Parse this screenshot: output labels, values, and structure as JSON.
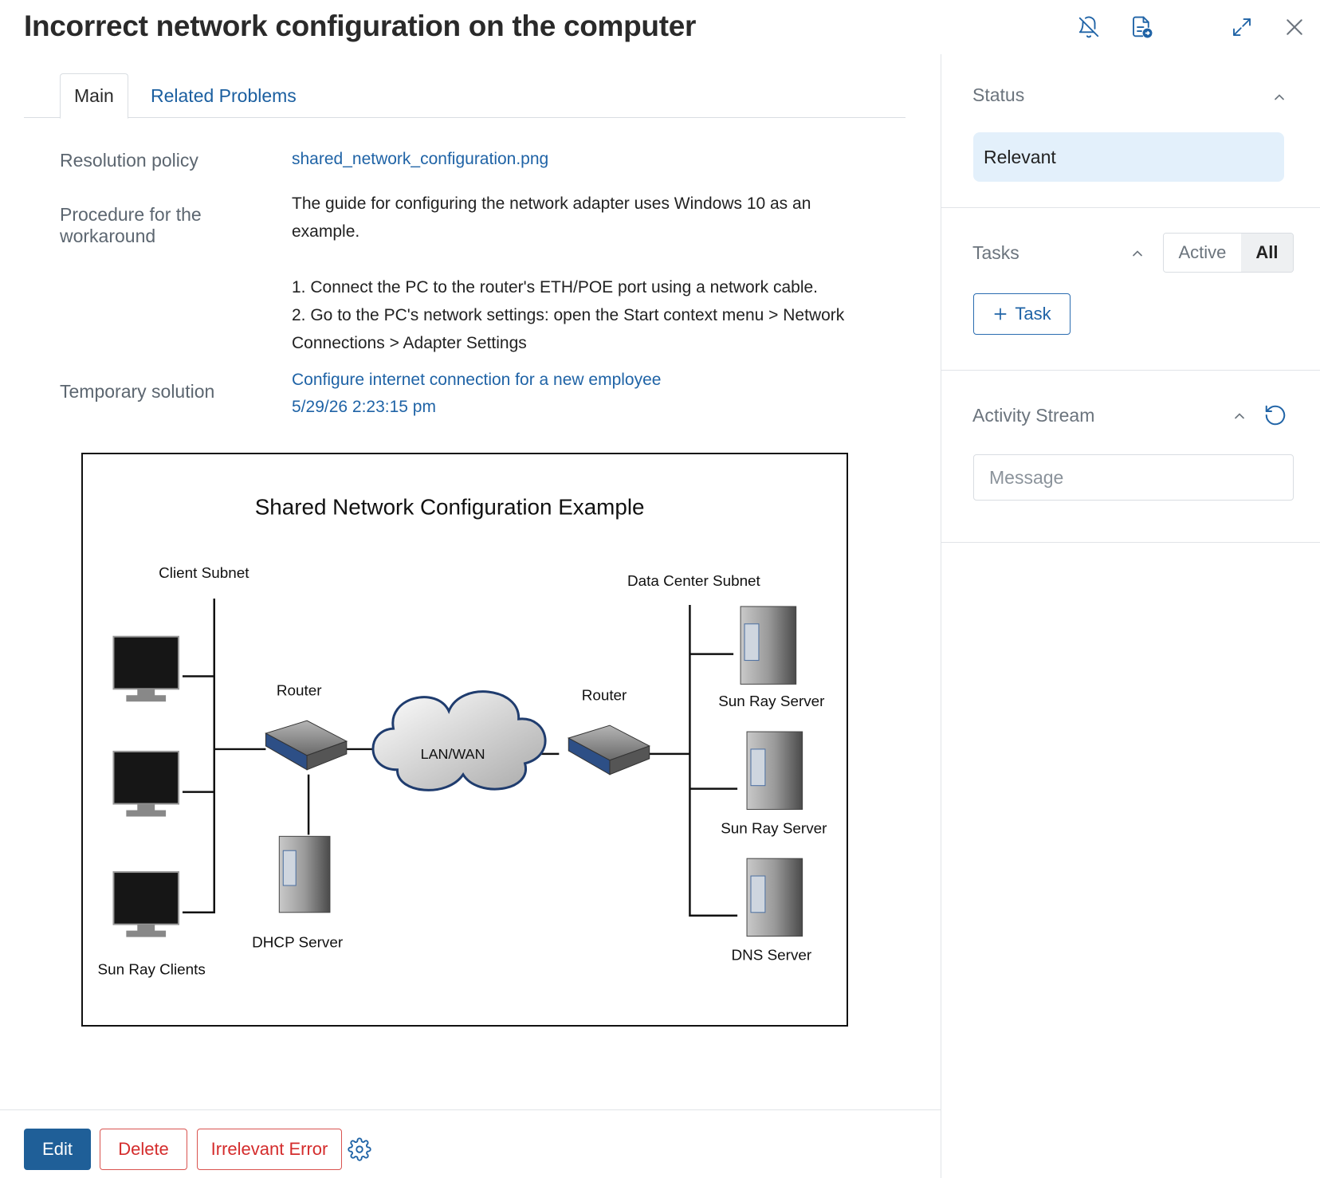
{
  "header": {
    "title": "Incorrect network configuration on the computer",
    "icons": [
      "bell-off-icon",
      "document-export-icon",
      "expand-icon",
      "close-icon"
    ]
  },
  "tabs": [
    {
      "label": "Main",
      "selected": true
    },
    {
      "label": "Related Problems",
      "selected": false
    }
  ],
  "fields": {
    "resolution_policy": {
      "label": "Resolution policy",
      "value": "shared_network_configuration.png"
    },
    "procedure": {
      "label_line1": "Procedure for the",
      "label_line2": "workaround",
      "intro_line1": "The guide for configuring the network adapter uses Windows 10 as an",
      "intro_line2": "example.",
      "step1": "1. Connect the PC to the router's ETH/POE port using a network cable.",
      "step2_line1": "2. Go to the PC's network settings: open the Start context menu > Network",
      "step2_line2": "Connections > Adapter Settings"
    },
    "temporary_solution": {
      "label": "Temporary solution",
      "link": "Configure internet connection for a new employee",
      "date": "5/29/26 2:23:15 pm"
    }
  },
  "diagram": {
    "title": "Shared Network Configuration Example",
    "client_subnet": "Client Subnet",
    "data_center_subnet": "Data Center Subnet",
    "router_left": "Router",
    "router_right": "Router",
    "cloud": "LAN/WAN",
    "dhcp": "DHCP Server",
    "clients": "Sun Ray Clients",
    "server1": "Sun Ray Server",
    "server2": "Sun Ray Server",
    "dns": "DNS Server"
  },
  "footer": {
    "edit": "Edit",
    "delete": "Delete",
    "irrelevant": "Irrelevant Error"
  },
  "sidebar": {
    "status": {
      "title": "Status",
      "value": "Relevant"
    },
    "tasks": {
      "title": "Tasks",
      "filter_active": "Active",
      "filter_all": "All",
      "add_label": "Task"
    },
    "activity": {
      "title": "Activity Stream",
      "message_placeholder": "Message"
    }
  },
  "colors": {
    "accent": "#1f5f98",
    "link": "#1f63a6",
    "danger": "#d42c2c",
    "status_bg": "#e3f0fb"
  }
}
